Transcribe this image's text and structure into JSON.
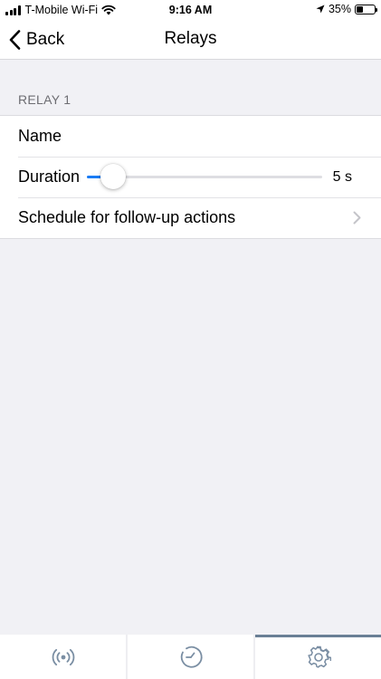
{
  "status_bar": {
    "carrier": "T-Mobile Wi-Fi",
    "time": "9:16 AM",
    "battery": "35%",
    "battery_fraction": 0.35
  },
  "nav": {
    "back_label": "Back",
    "title": "Relays"
  },
  "section": {
    "header": "RELAY 1",
    "rows": {
      "name_label": "Name",
      "duration_label": "Duration",
      "duration_value": "5 s",
      "duration_fraction": 0.11,
      "schedule_label": "Schedule for follow-up actions"
    }
  },
  "tab_bar": {
    "tabs": [
      {
        "icon": "broadcast-icon",
        "active": false
      },
      {
        "icon": "clock-icon",
        "active": false
      },
      {
        "icon": "gear-icon",
        "active": true
      }
    ]
  },
  "colors": {
    "accent": "#1a7cf5",
    "tab_indicator": "#6a7f95",
    "background": "#f1f1f5"
  }
}
